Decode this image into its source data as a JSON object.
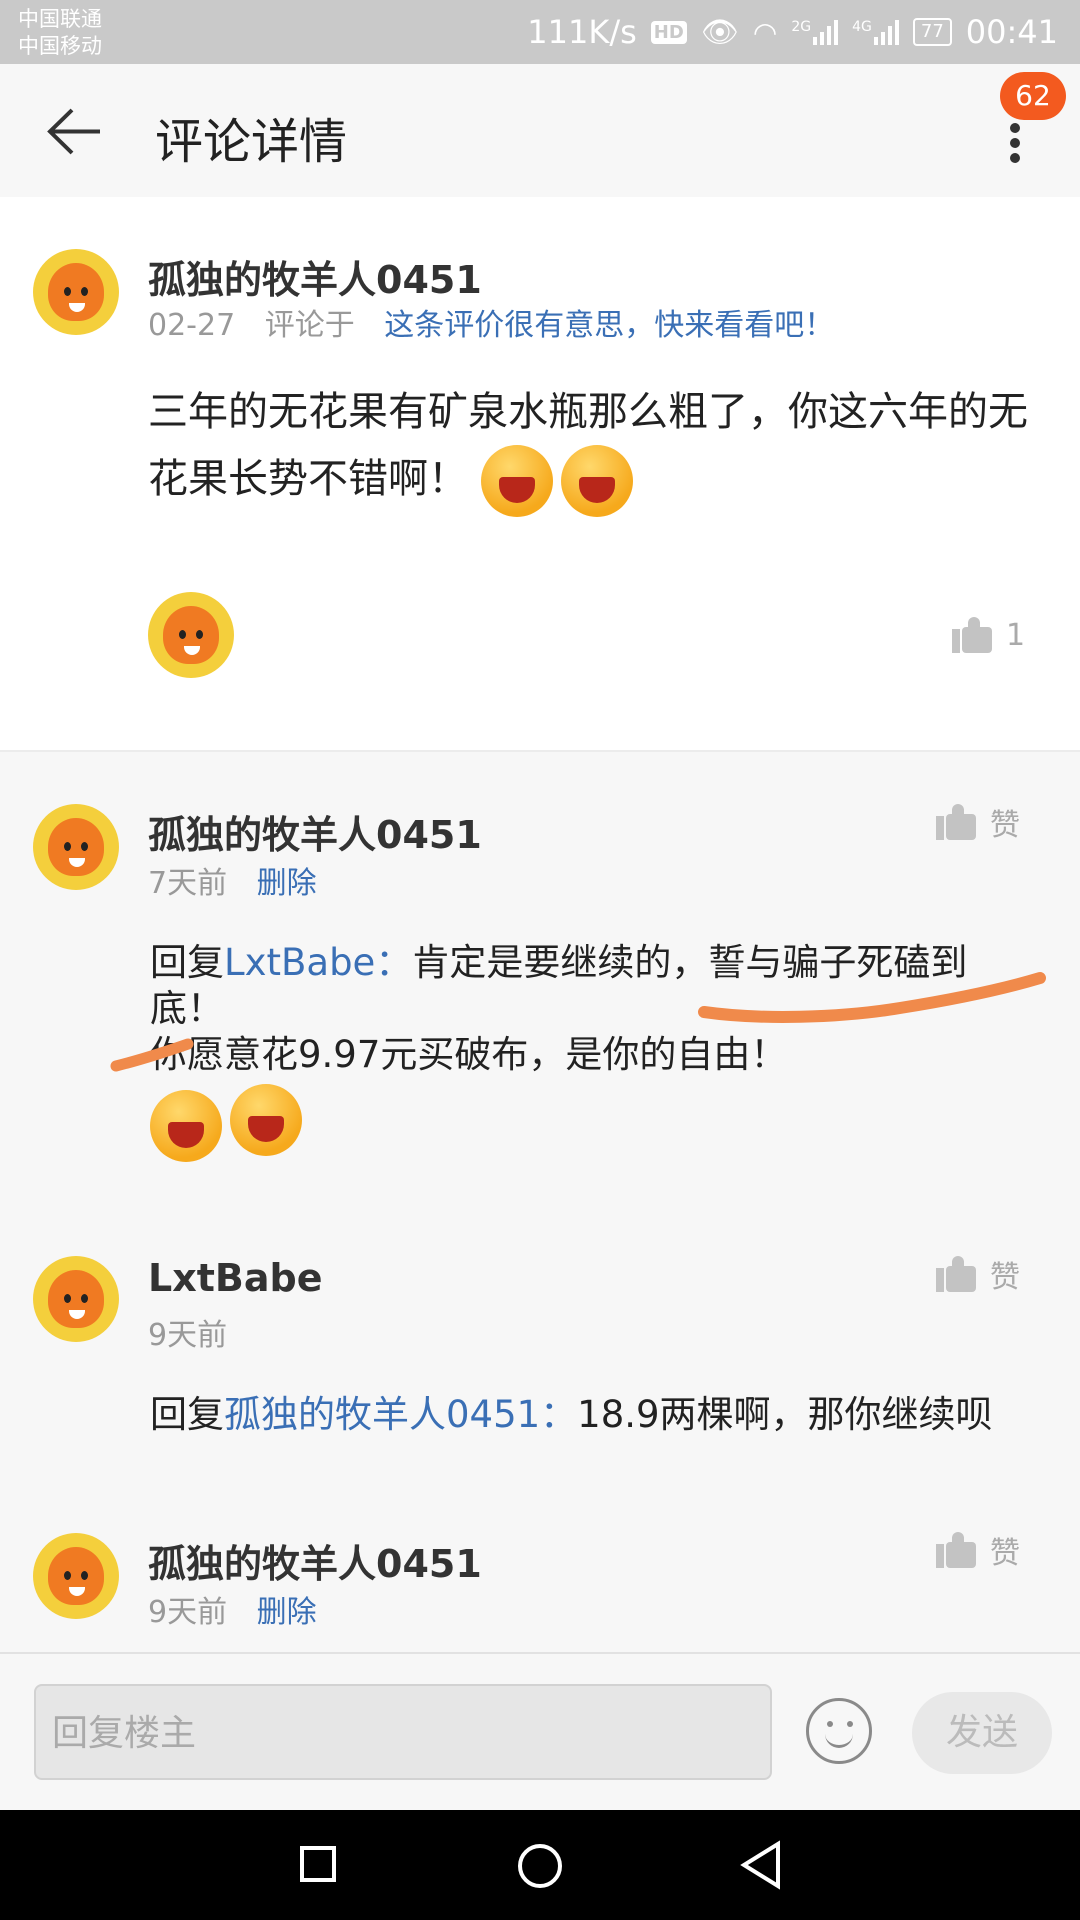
{
  "status_bar": {
    "carrier_1": "中国联通",
    "carrier_2": "中国移动",
    "speed": "111K/s",
    "hd": "HD",
    "net_2g": "2G",
    "net_4g": "4G",
    "battery": "77",
    "time": "00:41"
  },
  "header": {
    "title": "评论详情",
    "badge_count": "62"
  },
  "main_comment": {
    "username": "孤独的牧羊人0451",
    "date": "02-27",
    "commented_on": "评论于",
    "target_link": "这条评价很有意思，快来看看吧！",
    "text": "三年的无花果有矿泉水瓶那么粗了，你这六年的无花果长势不错啊！",
    "like_count": "1"
  },
  "replies": [
    {
      "username": "孤独的牧羊人0451",
      "time": "7天前",
      "action": "删除",
      "reply_prefix": "回复",
      "reply_to": "LxtBabe：",
      "text_line_1": "肯定是要继续的，誓与骗子死磕到底！",
      "text_line_2": "你愿意花9.97元买破布，是你的自由！",
      "like_label": "赞"
    },
    {
      "username": "LxtBabe",
      "time": "9天前",
      "reply_prefix": "回复",
      "reply_to": "孤独的牧羊人0451：",
      "text": "18.9两棵啊，那你继续呗",
      "like_label": "赞"
    },
    {
      "username": "孤独的牧羊人0451",
      "time": "9天前",
      "action": "删除",
      "like_label": "赞"
    }
  ],
  "reply_bar": {
    "placeholder": "回复楼主",
    "send_label": "发送"
  },
  "colors": {
    "link": "#3a6fb5",
    "badge": "#f35a1f",
    "annotation": "#f08a4b"
  },
  "icons": [
    "back-arrow-icon",
    "more-vert-icon",
    "thumb-up-icon",
    "emoji-icon",
    "laughing-emoji-icon",
    "nav-recent-icon",
    "nav-home-icon",
    "nav-back-icon"
  ]
}
